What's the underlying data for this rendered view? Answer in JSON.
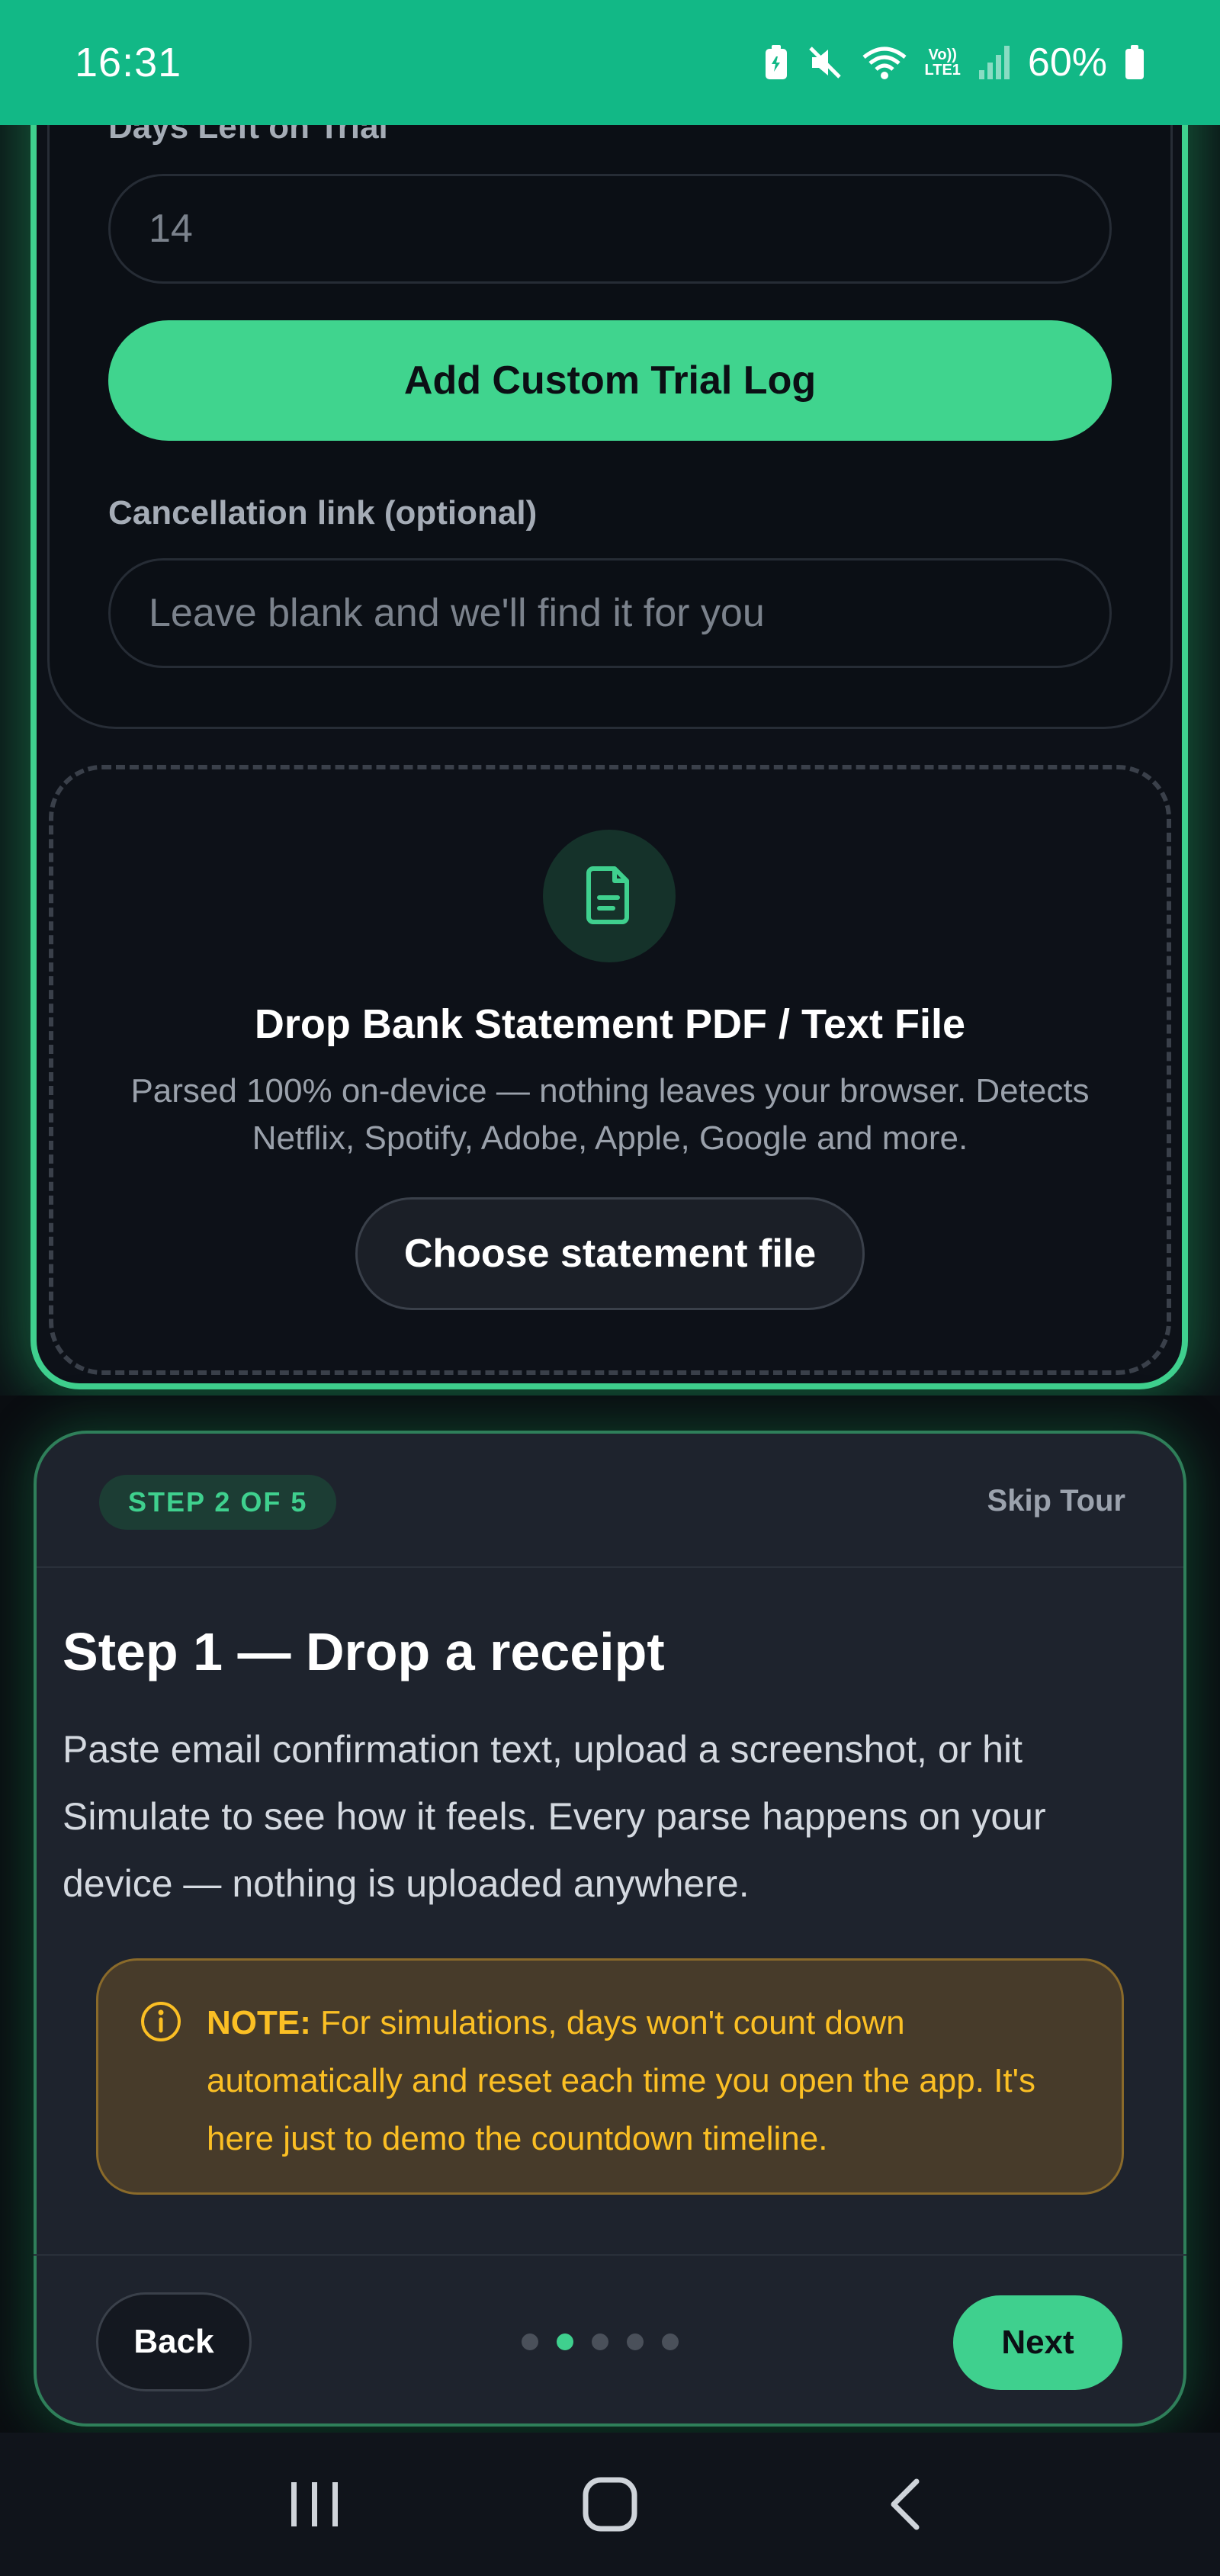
{
  "status_bar": {
    "time": "16:31",
    "lte_label": "Vo))\nLTE1",
    "battery": "60%",
    "icons": [
      "battery-saver-icon",
      "mute-icon",
      "wifi-icon",
      "volte-icon",
      "signal-icon",
      "battery-icon"
    ]
  },
  "form": {
    "days_label": "Days Left on Trial",
    "days_value": "14",
    "add_button": "Add Custom Trial Log",
    "cancel_label": "Cancellation link (optional)",
    "cancel_placeholder": "Leave blank and we'll find it for you"
  },
  "dropzone": {
    "icon": "file-text-icon",
    "title": "Drop Bank Statement PDF / Text File",
    "description": "Parsed 100% on-device — nothing leaves your browser. Detects Netflix, Spotify, Adobe, Apple, Google and more.",
    "button": "Choose statement file"
  },
  "tour": {
    "step_badge": "STEP 2 OF 5",
    "skip": "Skip Tour",
    "title": "Step 1 — Drop a receipt",
    "body": "Paste email confirmation text, upload a screenshot, or hit Simulate to see how it feels. Every parse happens on your device — nothing is uploaded anywhere.",
    "note_label": "NOTE:",
    "note_text": " For simulations, days won't count down automatically and reset each time you open the app. It's here just to demo the countdown timeline.",
    "back": "Back",
    "next": "Next",
    "total_steps": 5,
    "active_step": 2
  },
  "colors": {
    "status_bar": "#12b886",
    "accent": "#3fd08e",
    "note_text": "#fbbf24",
    "note_bg": "#473b2a",
    "surface": "#1e232d"
  },
  "nav_bar": {
    "icons": [
      "recent-apps-icon",
      "home-icon",
      "back-icon"
    ]
  }
}
